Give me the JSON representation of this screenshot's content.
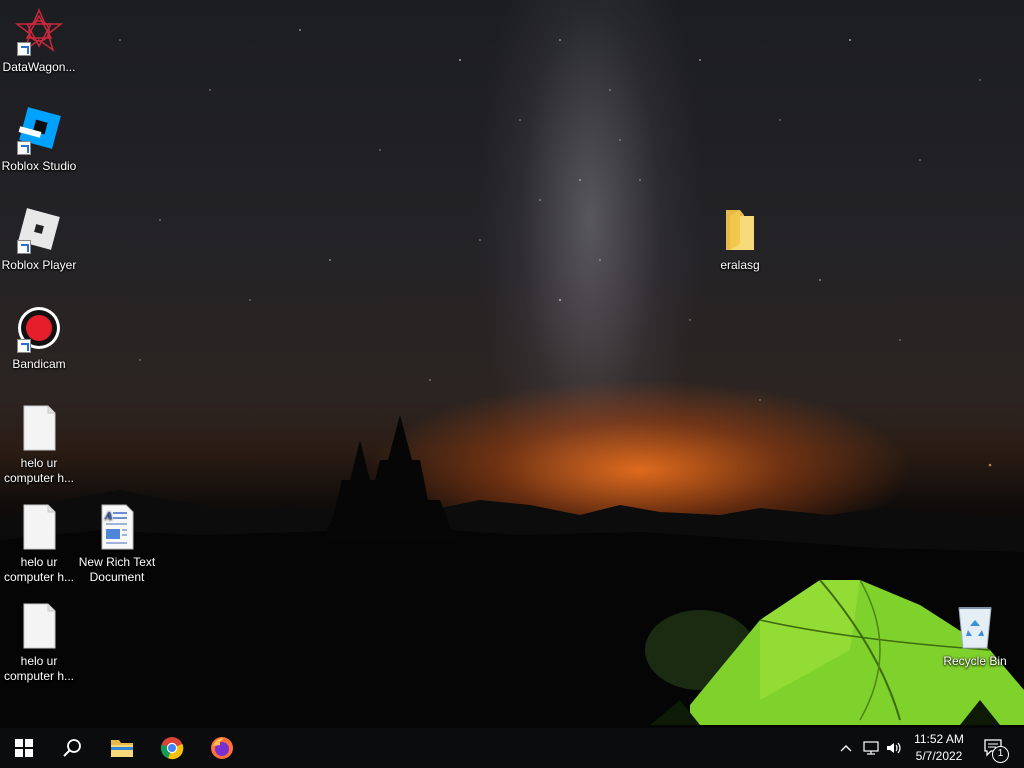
{
  "desktop_icons": {
    "datawagon": {
      "label": "DataWagon..."
    },
    "roblox_studio": {
      "label": "Roblox Studio"
    },
    "roblox_player": {
      "label": "Roblox Player"
    },
    "bandicam": {
      "label": "Bandicam"
    },
    "txt1": {
      "label": "helo ur computer h..."
    },
    "txt2": {
      "label": "helo ur computer h..."
    },
    "txt3": {
      "label": "helo ur computer h..."
    },
    "rtf": {
      "label": "New Rich Text Document"
    },
    "folder": {
      "label": "eralasg"
    },
    "recycle_bin": {
      "label": "Recycle Bin"
    }
  },
  "taskbar": {
    "pinned": [
      "start-icon",
      "search-icon",
      "file-explorer-icon",
      "chrome-icon",
      "firefox-icon"
    ],
    "clock": {
      "time": "11:52 AM",
      "date": "5/7/2022"
    },
    "notifications_count": "1"
  }
}
